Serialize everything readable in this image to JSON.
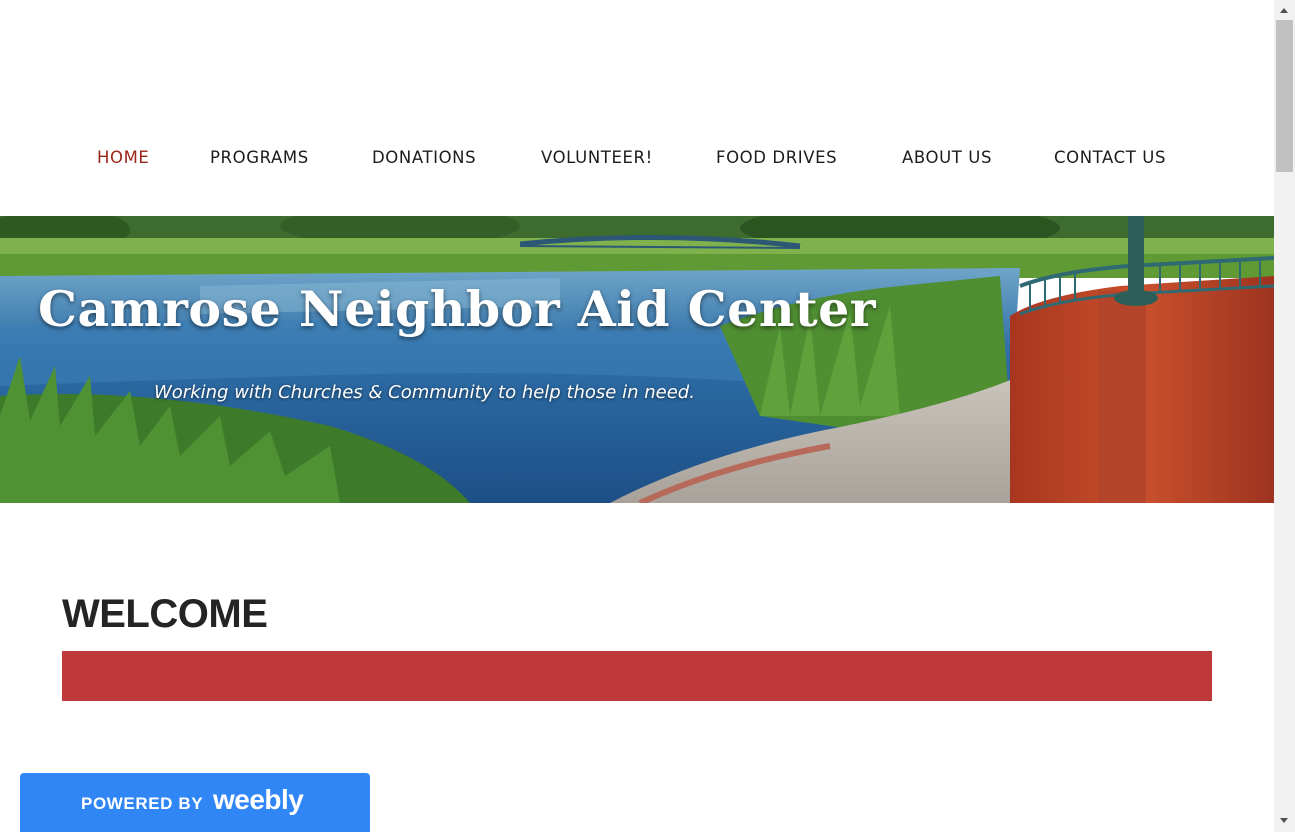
{
  "nav": {
    "items": [
      {
        "label": "HOME",
        "active": true
      },
      {
        "label": "PROGRAMS"
      },
      {
        "label": "DONATIONS"
      },
      {
        "label": "VOLUNTEER!"
      },
      {
        "label": "FOOD DRIVES"
      },
      {
        "label": "ABOUT US"
      },
      {
        "label": "CONTACT US"
      }
    ],
    "active_color": "#9b2419"
  },
  "banner": {
    "title": "Camrose Neighbor Aid Center",
    "tagline": "Working with Churches & Community to help those in need."
  },
  "main": {
    "heading": "WELCOME",
    "accent_color": "#bf383a"
  },
  "badge": {
    "powered_by": "POWERED BY",
    "brand": "weebly",
    "color": "#3186f6"
  }
}
